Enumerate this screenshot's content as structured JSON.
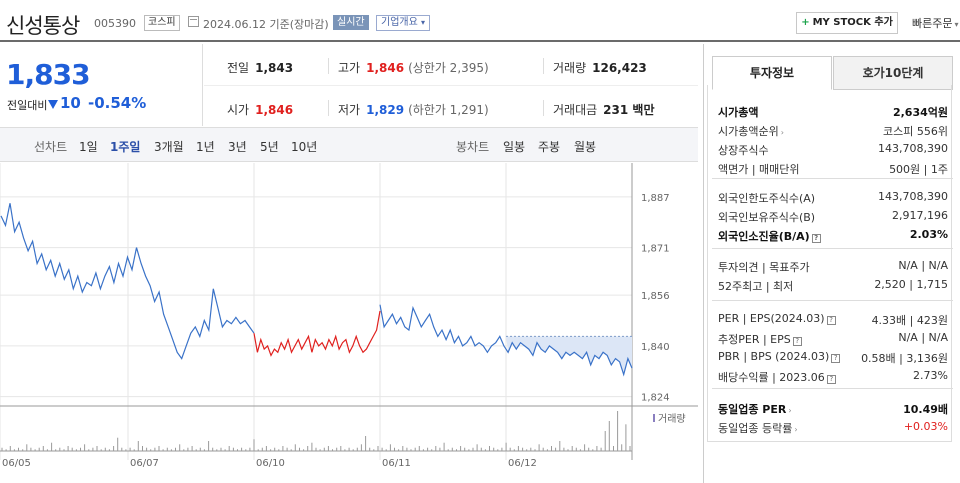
{
  "header": {
    "name": "신성통상",
    "code": "005390",
    "market": "코스피",
    "date": "2024.06.12 기준(장마감)",
    "realtime": "실시간",
    "corp_overview": "기업개요",
    "mystock": "MY STOCK 추가",
    "quick_order": "빠른주문"
  },
  "price": {
    "current": "1,833",
    "change_label": "전일대비",
    "change": "10",
    "change_pct": "-0.54%"
  },
  "stats": {
    "prev_label": "전일",
    "prev": "1,843",
    "high_label": "고가",
    "high": "1,846",
    "upper_limit": "(상한가 2,395)",
    "volume_label": "거래량",
    "volume": "126,423",
    "open_label": "시가",
    "open": "1,846",
    "low_label": "저가",
    "low": "1,829",
    "lower_limit": "(하한가 1,291)",
    "amount_label": "거래대금",
    "amount": "231 백만"
  },
  "period_tabs": {
    "line_title": "선차트",
    "line": [
      "1일",
      "1주일",
      "3개월",
      "1년",
      "3년",
      "5년",
      "10년"
    ],
    "candle_title": "봉차트",
    "candle": [
      "일봉",
      "주봉",
      "월봉"
    ]
  },
  "chart_data": {
    "type": "line",
    "x_labels": [
      "06/05",
      "06/07",
      "06/10",
      "06/11",
      "06/12"
    ],
    "y_ticks": [
      1887,
      1871,
      1856,
      1840,
      1824
    ],
    "ylim": [
      1822,
      1892
    ],
    "volume_label": "거래량",
    "series": [
      {
        "color": "#3a72c8",
        "values": [
          1881,
          1878,
          1885,
          1876,
          1879,
          1874,
          1870,
          1873,
          1866,
          1869,
          1864,
          1867,
          1862,
          1866,
          1861,
          1864,
          1858,
          1862,
          1857,
          1860,
          1859,
          1863,
          1858,
          1862,
          1865,
          1860,
          1866,
          1862,
          1868,
          1864,
          1871,
          1866,
          1862,
          1859,
          1854,
          1857,
          1850,
          1846,
          1842,
          1838,
          1836,
          1840,
          1844,
          1846,
          1843,
          1848,
          1845,
          1858,
          1852,
          1846,
          1848,
          1847,
          1849,
          1847,
          1848,
          1846,
          1844
        ]
      },
      {
        "color": "#e0201e",
        "values": [
          1844,
          1838,
          1842,
          1839,
          1840,
          1837,
          1839,
          1838,
          1841,
          1839,
          1842,
          1838,
          1840,
          1842,
          1839,
          1841,
          1843,
          1838,
          1842,
          1840,
          1841,
          1839,
          1842,
          1840,
          1843,
          1839,
          1841,
          1842,
          1838,
          1840,
          1843,
          1840,
          1838,
          1839,
          1841,
          1843,
          1845,
          1851
        ]
      },
      {
        "color": "#3a72c8",
        "values": [
          1853,
          1846,
          1848,
          1850,
          1847,
          1849,
          1846,
          1845,
          1852,
          1849,
          1846,
          1848,
          1850,
          1846,
          1843,
          1845,
          1842,
          1845,
          1841,
          1843,
          1840,
          1841,
          1843,
          1840,
          1841,
          1840,
          1838,
          1840,
          1841,
          1843,
          1840,
          1838,
          1841,
          1839,
          1841,
          1840,
          1839,
          1837,
          1841,
          1839,
          1838,
          1840,
          1839,
          1838,
          1836,
          1838,
          1837,
          1838,
          1837,
          1836,
          1838,
          1834,
          1837,
          1836,
          1838,
          1837,
          1834,
          1836,
          1835,
          1831,
          1836,
          1833
        ]
      }
    ],
    "prev_close": 1843,
    "volume": [
      2,
      1,
      3,
      1,
      2,
      1,
      4,
      2,
      1,
      2,
      3,
      1,
      5,
      1,
      2,
      1,
      3,
      2,
      1,
      2,
      4,
      1,
      2,
      3,
      1,
      2,
      1,
      3,
      8,
      2,
      1,
      2,
      1,
      6,
      3,
      2,
      1,
      2,
      3,
      1,
      2,
      1,
      2,
      4,
      1,
      2,
      3,
      1,
      2,
      1,
      6,
      2,
      1,
      2,
      1,
      3,
      2,
      1,
      2,
      1,
      2,
      7,
      1,
      2,
      3,
      1,
      2,
      1,
      3,
      2,
      1,
      4,
      2,
      1,
      3,
      5,
      2,
      1,
      2,
      3,
      1,
      2,
      3,
      1,
      2,
      1,
      2,
      4,
      9,
      2,
      1,
      3,
      2,
      1,
      4,
      2,
      1,
      3,
      2,
      1,
      2,
      3,
      1,
      2,
      1,
      3,
      2,
      5,
      1,
      2,
      1,
      3,
      2,
      1,
      2,
      4,
      2,
      1,
      3,
      2,
      1,
      2,
      5,
      2,
      1,
      3,
      2,
      1,
      2,
      1,
      4,
      2,
      1,
      3,
      2,
      6,
      2,
      1,
      3,
      2,
      1,
      4,
      2,
      1,
      3,
      2,
      12,
      18,
      3,
      24,
      4,
      16,
      3
    ]
  },
  "invest": {
    "tab1": "투자정보",
    "tab2": "호가10단계",
    "g1": [
      {
        "k": "시가총액",
        "v": "2,634억원",
        "bold": true
      },
      {
        "k": "시가총액순위",
        "v": "코스피 556위",
        "arrow": true
      },
      {
        "k": "상장주식수",
        "v": "143,708,390"
      },
      {
        "k": "액면가 | 매매단위",
        "v": "500원 | 1주"
      }
    ],
    "g2": [
      {
        "k": "외국인한도주식수(A)",
        "v": "143,708,390"
      },
      {
        "k": "외국인보유주식수(B)",
        "v": "2,917,196"
      },
      {
        "k": "외국인소진율(B/A)",
        "v": "2.03%",
        "bold": true,
        "q": true
      }
    ],
    "g3": [
      {
        "k": "투자의견 | 목표주가",
        "v": "N/A | N/A"
      },
      {
        "k": "52주최고 | 최저",
        "v": "2,520 | 1,715"
      }
    ],
    "g4": [
      {
        "k": "PER | EPS(2024.03)",
        "v": "4.33배 | 423원",
        "q": true
      },
      {
        "k": "추정PER | EPS",
        "v": "N/A | N/A",
        "q": true
      },
      {
        "k": "PBR | BPS (2024.03)",
        "v": "0.58배 | 3,136원",
        "q": true
      },
      {
        "k": "배당수익률 | 2023.06",
        "v": "2.73%",
        "q": true
      }
    ],
    "g5": [
      {
        "k": "동일업종 PER",
        "v": "10.49배",
        "bold": true,
        "arrow": true
      },
      {
        "k": "동일업종 등락률",
        "v": "+0.03%",
        "arrow": true,
        "red": true
      }
    ]
  }
}
